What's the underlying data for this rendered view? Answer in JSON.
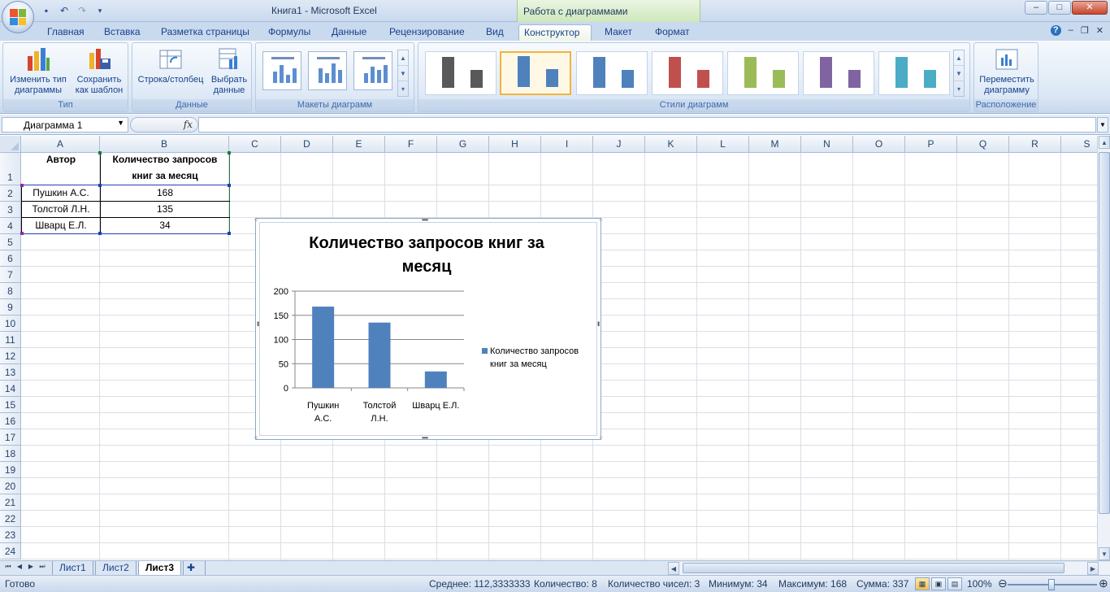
{
  "window": {
    "title": "Книга1 - Microsoft Excel",
    "context_tab_title": "Работа с диаграммами",
    "controls": [
      "–",
      "□",
      "✕"
    ]
  },
  "qat": {
    "save_icon": "floppy-icon",
    "undo_icon": "undo-icon",
    "redo_icon": "redo-icon"
  },
  "ribbon": {
    "tabs": [
      "Главная",
      "Вставка",
      "Разметка страницы",
      "Формулы",
      "Данные",
      "Рецензирование",
      "Вид",
      "Конструктор",
      "Макет",
      "Формат"
    ],
    "active_tab": "Конструктор",
    "groups": {
      "type": {
        "label": "Тип",
        "btn_change_type": [
          "Изменить тип",
          "диаграммы"
        ],
        "btn_save_template": [
          "Сохранить",
          "как шаблон"
        ]
      },
      "data": {
        "label": "Данные",
        "btn_row_col": "Строка/столбец",
        "btn_select_data": [
          "Выбрать",
          "данные"
        ]
      },
      "layouts": {
        "label": "Макеты диаграмм"
      },
      "styles": {
        "label": "Стили диаграмм",
        "colors": [
          "#595959",
          "#4f81bd",
          "#4f81bd",
          "#c0504d",
          "#9bbb59",
          "#8064a2",
          "#4bacc6"
        ]
      },
      "location": {
        "label": "Расположение",
        "btn_move": [
          "Переместить",
          "диаграмму"
        ]
      }
    }
  },
  "formula_bar": {
    "name_box": "Диаграмма 1",
    "fx": "fx",
    "value": ""
  },
  "sheet": {
    "columns": [
      "A",
      "B",
      "C",
      "D",
      "E",
      "F",
      "G",
      "H",
      "I",
      "J",
      "K",
      "L",
      "M",
      "N",
      "O",
      "P",
      "Q",
      "R",
      "S"
    ],
    "rows": [
      "1",
      "2",
      "3",
      "4",
      "5",
      "6",
      "7",
      "8",
      "9",
      "10",
      "11",
      "12",
      "13",
      "14",
      "15",
      "16",
      "17",
      "18",
      "19",
      "20",
      "21",
      "22",
      "23",
      "24"
    ],
    "cells": {
      "A1": "Автор",
      "B1_line1": "Количество запросов",
      "B1_line2": "книг за месяц",
      "A2": "Пушкин А.С.",
      "B2": "168",
      "A3": "Толстой Л.Н.",
      "B3": "135",
      "A4": "Шварц Е.Л.",
      "B4": "34"
    }
  },
  "chart_data": {
    "type": "bar",
    "title": [
      "Количество запросов книг за",
      "месяц"
    ],
    "categories": [
      [
        "Пушкин",
        "А.С."
      ],
      [
        "Толстой",
        "Л.Н."
      ],
      [
        "Шварц Е.Л."
      ]
    ],
    "series": [
      {
        "name": [
          "Количество запросов",
          "книг за месяц"
        ],
        "values": [
          168,
          135,
          34
        ],
        "color": "#4f81bd"
      }
    ],
    "ylim": [
      0,
      200
    ],
    "yticks": [
      0,
      50,
      100,
      150,
      200
    ],
    "grid": true,
    "legend": "right"
  },
  "sheet_tabs": {
    "tabs": [
      "Лист1",
      "Лист2",
      "Лист3"
    ],
    "active": "Лист3"
  },
  "status": {
    "ready": "Готово",
    "average": "Среднее: 112,3333333",
    "count": "Количество: 8",
    "numeric_count": "Количество чисел: 3",
    "min": "Минимум: 34",
    "max": "Максимум: 168",
    "sum": "Сумма: 337",
    "zoom": "100%"
  }
}
